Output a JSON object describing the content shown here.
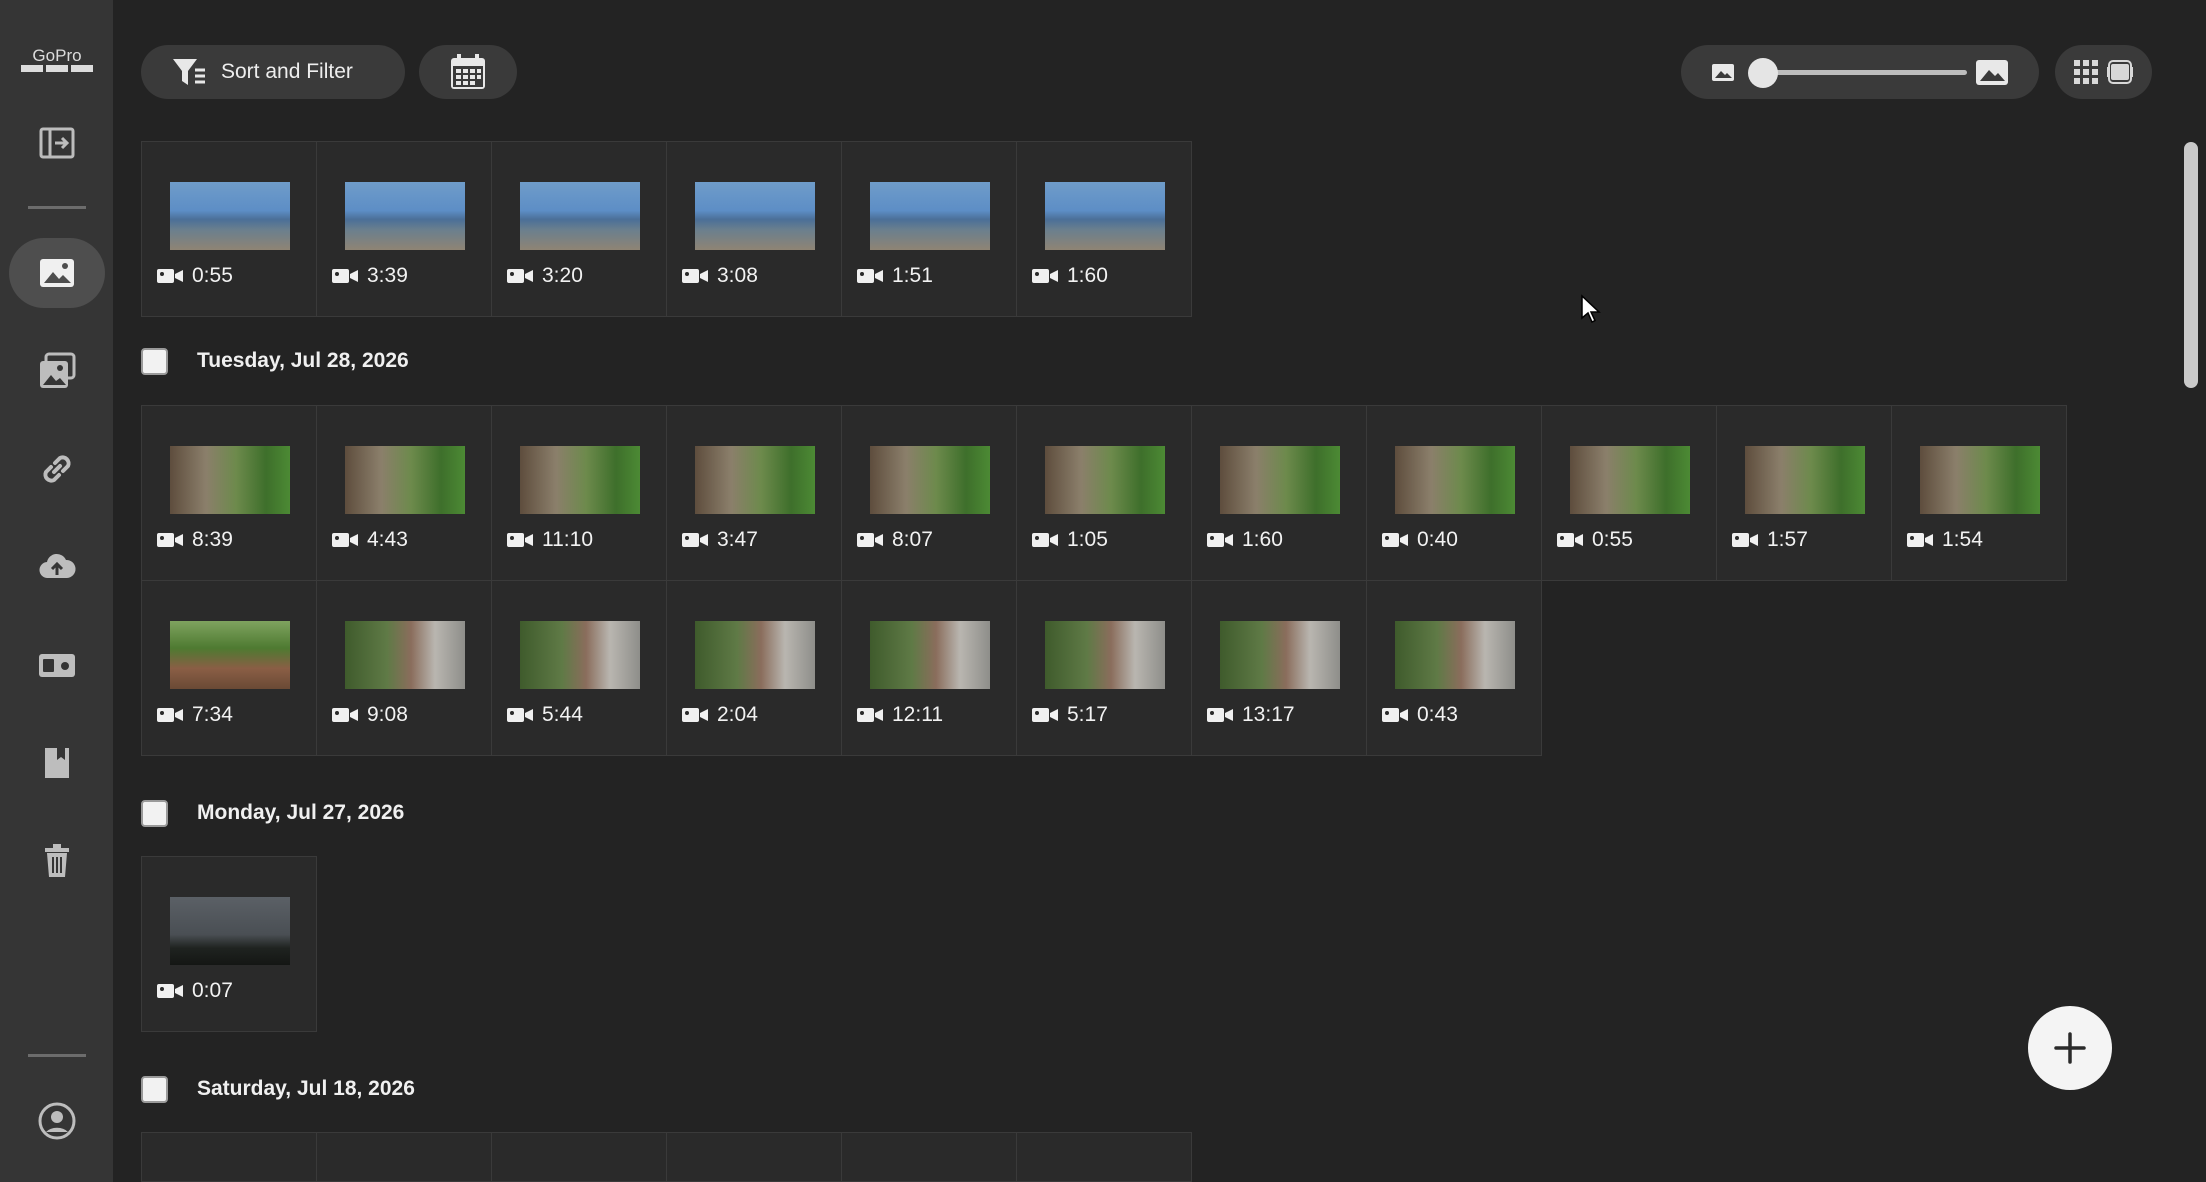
{
  "app": {
    "logo_text": "GoPro"
  },
  "toolbar": {
    "sort_filter_label": "Sort and Filter"
  },
  "groups": [
    {
      "date": "",
      "durations": [
        "0:55",
        "3:39",
        "3:20",
        "3:08",
        "1:51",
        "1:60"
      ]
    },
    {
      "date": "Tuesday, Jul 28, 2026",
      "durations": [
        "8:39",
        "4:43",
        "11:10",
        "3:47",
        "8:07",
        "1:05",
        "1:60",
        "0:40",
        "0:55",
        "1:57",
        "1:54",
        "7:34",
        "9:08",
        "5:44",
        "2:04",
        "12:11",
        "5:17",
        "13:17",
        "0:43"
      ]
    },
    {
      "date": "Monday, Jul 27, 2026",
      "durations": [
        "0:07"
      ]
    },
    {
      "date": "Saturday, Jul 18, 2026",
      "durations": []
    }
  ],
  "colors": {
    "background": "#232323",
    "sidebar": "#353535",
    "tile": "#2a2a2a",
    "accent_fab": "#f4f4f4"
  }
}
